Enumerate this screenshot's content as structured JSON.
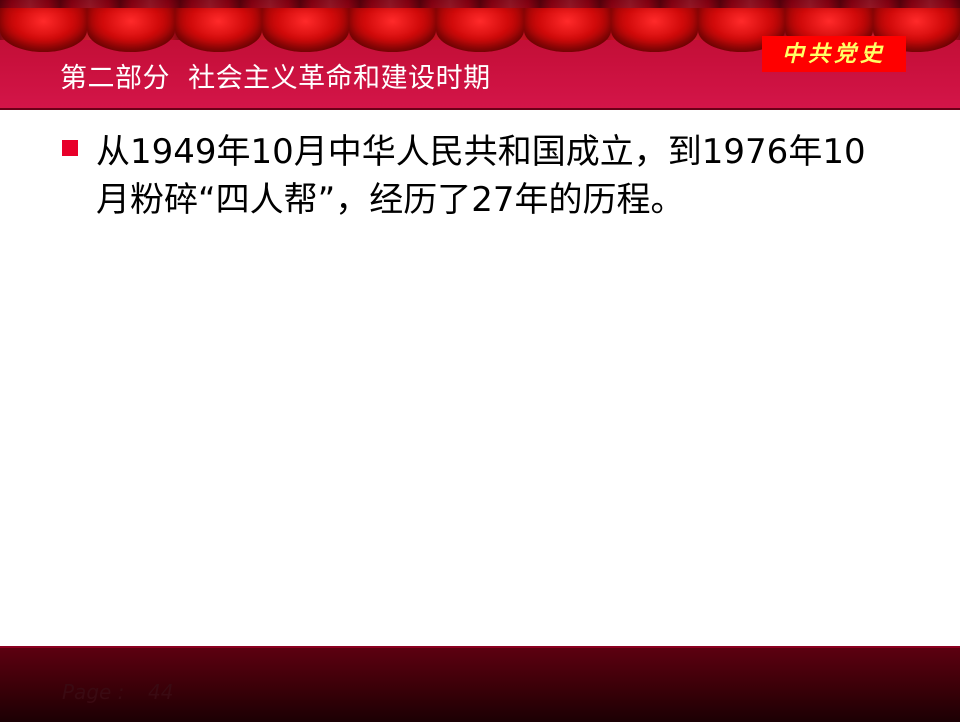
{
  "header": {
    "title": "第二部分  社会主义革命和建设时期",
    "badge": "中共党史"
  },
  "content": {
    "bullet": "从1949年10月中华人民共和国成立，到1976年10月粉碎“四人帮”，经历了27年的历程。"
  },
  "footer": {
    "page_label": "Page  :",
    "page_number": "44"
  }
}
